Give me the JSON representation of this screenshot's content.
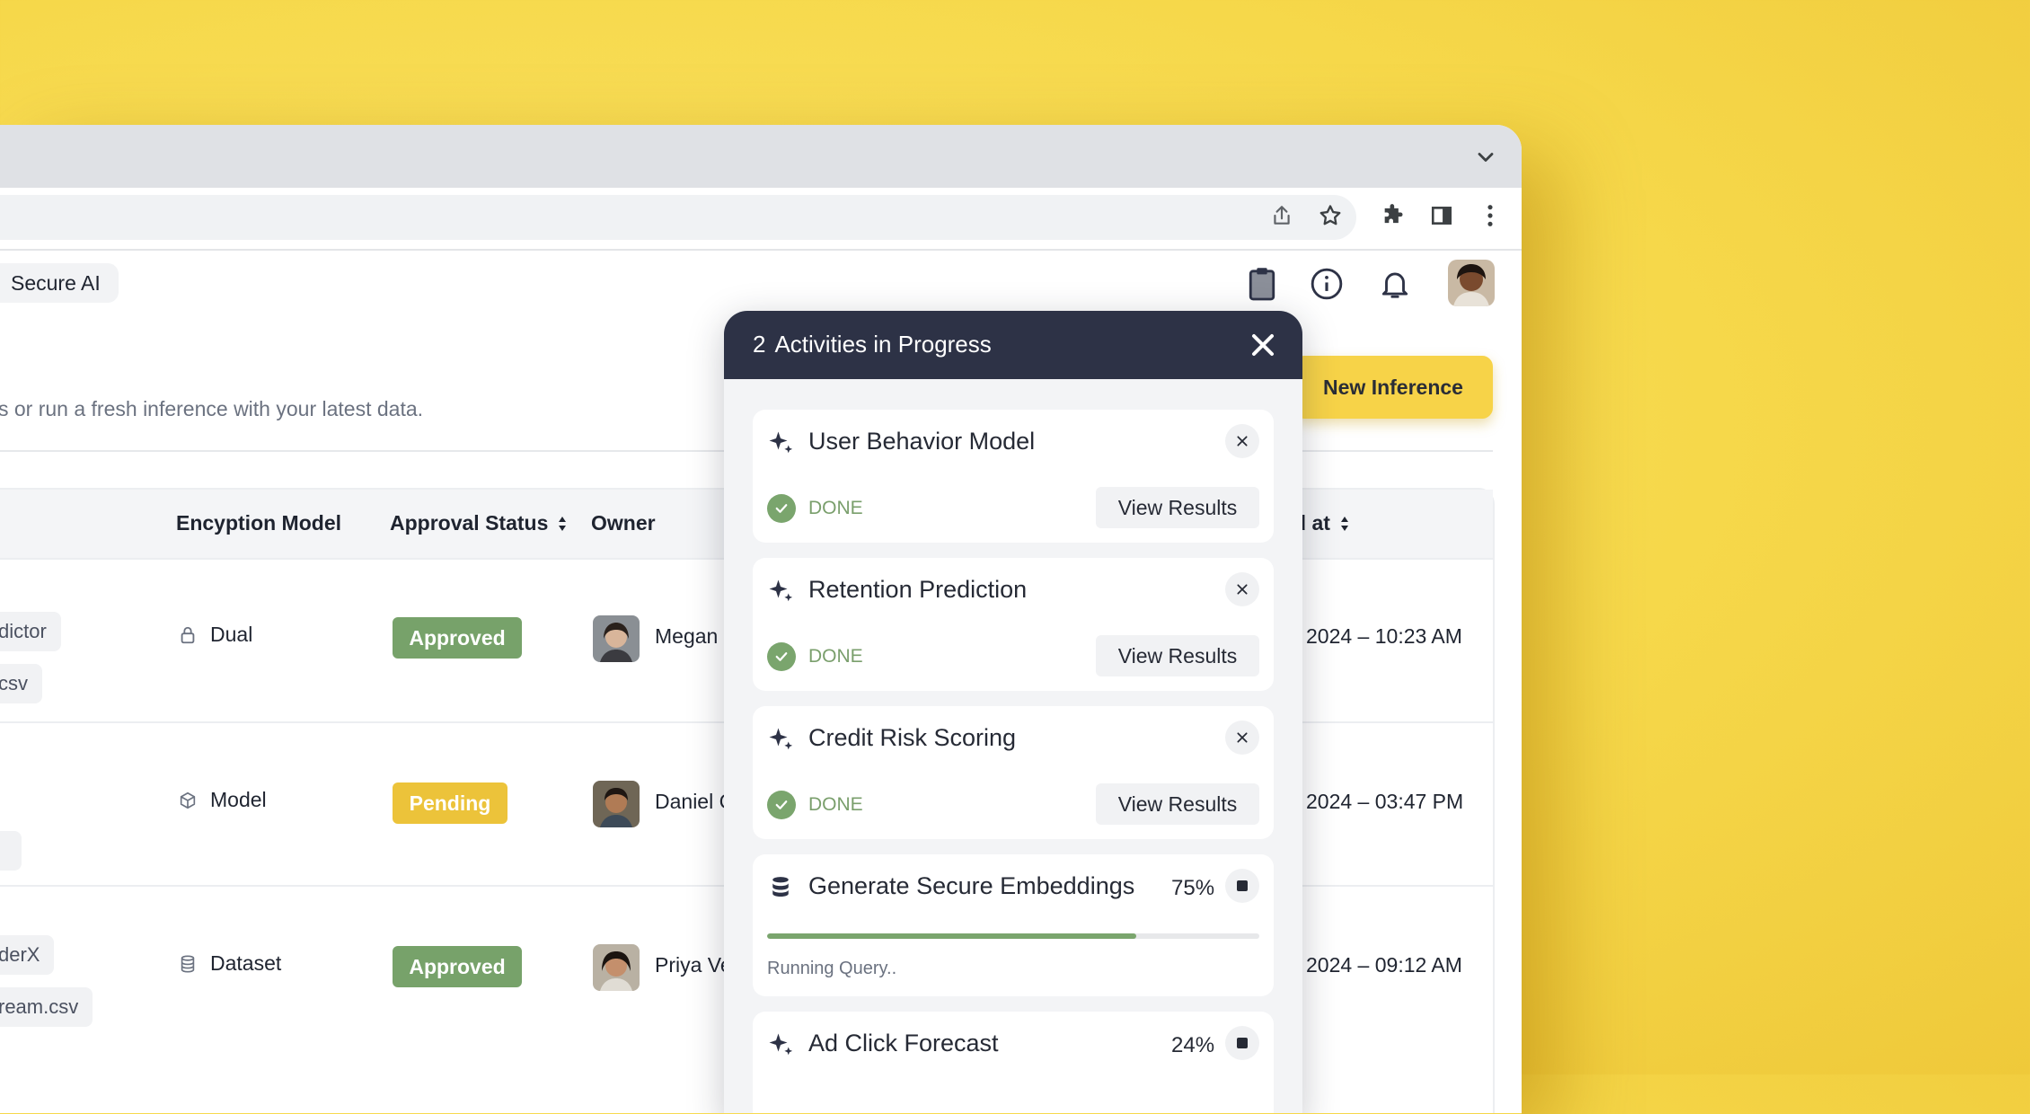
{
  "app": {
    "breadcrumb": "Secure AI",
    "subtitle": "s or run a fresh inference with your latest data.",
    "new_inference_label": "New Inference",
    "accent_color": "#f7d348"
  },
  "toolbar_icons": [
    "share-icon",
    "star-icon",
    "puzzle-icon",
    "sidebar-icon",
    "kebab-menu-icon"
  ],
  "header_icons": [
    "clipboard-icon",
    "info-icon",
    "bell-icon"
  ],
  "table": {
    "headers": {
      "model": "Encyption Model",
      "approval": "Approval Status",
      "owner": "Owner",
      "date": "d at"
    },
    "rows": [
      {
        "chips": [
          "dictor",
          "csv"
        ],
        "model_icon": "lock-icon",
        "model": "Dual",
        "status": "Approved",
        "status_color": "#77a26a",
        "owner": "Megan J",
        "date": "2024 – 10:23 AM"
      },
      {
        "chips": [
          ""
        ],
        "model_icon": "cube-icon",
        "model": "Model",
        "status": "Pending",
        "status_color": "#ecc33a",
        "owner": "Daniel C",
        "date": "2024 – 03:47 PM"
      },
      {
        "chips": [
          "derX",
          "ream.csv"
        ],
        "model_icon": "database-icon",
        "model": "Dataset",
        "status": "Approved",
        "status_color": "#77a26a",
        "owner": "Priya Ve",
        "date": "2024 – 09:12 AM"
      }
    ]
  },
  "activity_panel": {
    "count": "2",
    "title": "Activities in Progress",
    "cards": [
      {
        "title": "User Behavior Model",
        "icon": "sparkle-icon",
        "status": "DONE",
        "action": "View Results"
      },
      {
        "title": "Retention Prediction",
        "icon": "sparkle-icon",
        "status": "DONE",
        "action": "View Results"
      },
      {
        "title": "Credit Risk Scoring",
        "icon": "sparkle-icon",
        "status": "DONE",
        "action": "View Results"
      }
    ],
    "running": [
      {
        "title": "Generate Secure Embeddings",
        "icon": "database-icon",
        "percent": "75%",
        "progress": 0.75,
        "status_text": "Running Query.."
      },
      {
        "title": "Ad Click Forecast",
        "icon": "sparkle-icon",
        "percent": "24%",
        "progress": 0.24
      }
    ]
  }
}
